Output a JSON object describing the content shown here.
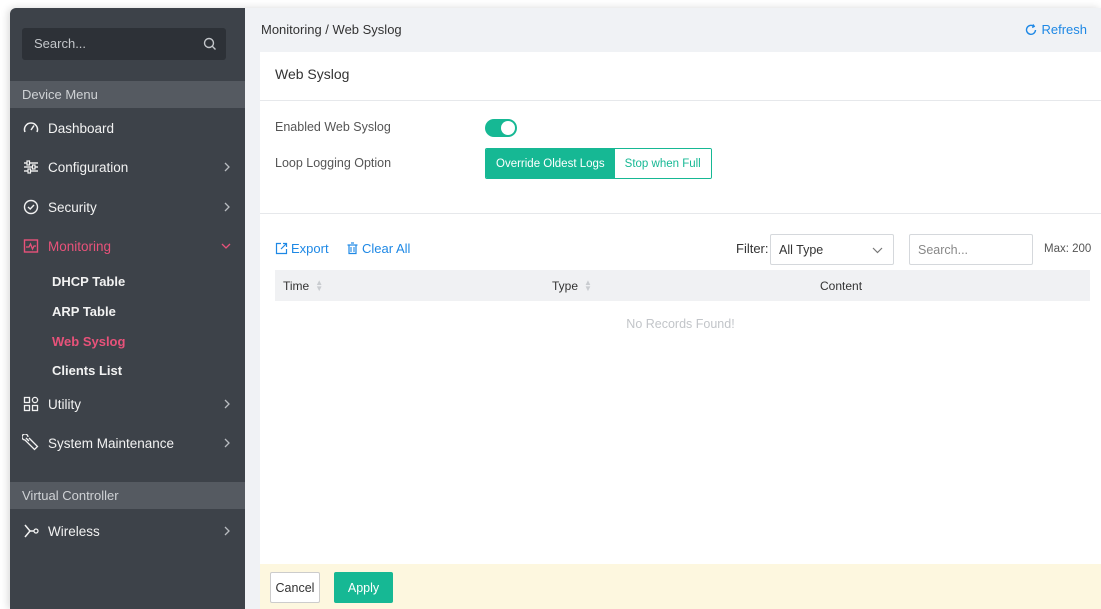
{
  "sidebar": {
    "search_placeholder": "Search...",
    "device_menu_label": "Device Menu",
    "virtual_controller_label": "Virtual Controller",
    "items": [
      {
        "label": "Dashboard",
        "icon": "dashboard-gauge-icon"
      },
      {
        "label": "Configuration",
        "icon": "sliders-icon"
      },
      {
        "label": "Security",
        "icon": "shield-check-icon"
      },
      {
        "label": "Monitoring",
        "icon": "monitor-chart-icon"
      },
      {
        "label": "Utility",
        "icon": "grid-apps-icon"
      },
      {
        "label": "System Maintenance",
        "icon": "wrench-icon"
      }
    ],
    "monitoring_sub": [
      "DHCP Table",
      "ARP Table",
      "Web Syslog",
      "Clients List"
    ],
    "wireless_label": "Wireless",
    "active_color": "#e8527a"
  },
  "header": {
    "breadcrumb": "Monitoring / Web Syslog",
    "refresh_label": "Refresh"
  },
  "panel": {
    "title": "Web Syslog",
    "enabled_label": "Enabled Web Syslog",
    "enabled": true,
    "loop_label": "Loop Logging Option",
    "loop_options": [
      "Override Oldest Logs",
      "Stop when Full"
    ],
    "loop_selected": "Override Oldest Logs"
  },
  "toolbar": {
    "export_label": "Export",
    "clear_label": "Clear All",
    "filter_label": "Filter:",
    "filter_value": "All Type",
    "search_placeholder": "Search...",
    "max_label": "Max: 200"
  },
  "table": {
    "columns": [
      "Time",
      "Type",
      "Content"
    ],
    "empty_text": "No Records Found!"
  },
  "footer": {
    "cancel_label": "Cancel",
    "apply_label": "Apply"
  },
  "colors": {
    "accent": "#16b894",
    "link": "#1e88e5",
    "sidebar_bg": "#3d4249"
  }
}
